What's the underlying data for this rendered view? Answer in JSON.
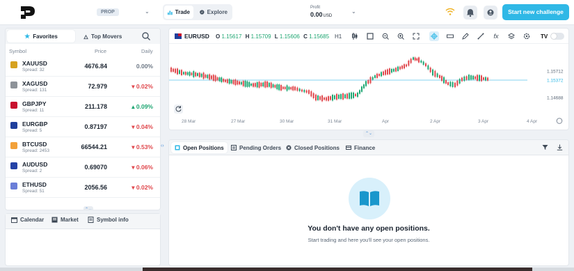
{
  "header": {
    "badge": "PROP",
    "mode_trade": "Trade",
    "mode_explore": "Explore",
    "profit_label": "Profit",
    "profit_value": "0.00",
    "profit_currency": "USD",
    "cta": "Start new challenge",
    "brand_color": "#2fb8e6"
  },
  "watchlist": {
    "tab_favorites": "Favorites",
    "tab_top_movers": "Top Movers",
    "col_symbol": "Symbol",
    "col_price": "Price",
    "col_daily": "Daily",
    "rows": [
      {
        "symbol": "XAUUSD",
        "spread": "Spread: 32",
        "price": "4676.84",
        "daily": "0.00%",
        "dir": "neu",
        "flag": "#d6a220"
      },
      {
        "symbol": "XAGUSD",
        "spread": "Spread: 131",
        "price": "72.979",
        "daily": "0.02%",
        "dir": "neg",
        "flag": "#8e9399"
      },
      {
        "symbol": "GBPJPY",
        "spread": "Spread: 11",
        "price": "211.178",
        "daily": "0.09%",
        "dir": "pos",
        "flag": "#c8102e"
      },
      {
        "symbol": "EURGBP",
        "spread": "Spread: 5",
        "price": "0.87197",
        "daily": "0.04%",
        "dir": "neg",
        "flag": "#1f3f9c"
      },
      {
        "symbol": "BTCUSD",
        "spread": "Spread: 2453",
        "price": "66544.21",
        "daily": "0.53%",
        "dir": "neg",
        "flag": "#f2a13a"
      },
      {
        "symbol": "AUDUSD",
        "spread": "Spread: 2",
        "price": "0.69070",
        "daily": "0.06%",
        "dir": "neg",
        "flag": "#2442a6"
      },
      {
        "symbol": "ETHUSD",
        "spread": "Spread: 51",
        "price": "2056.56",
        "daily": "0.02%",
        "dir": "neg",
        "flag": "#6b7ed8"
      }
    ]
  },
  "bottom_tabs": {
    "calendar": "Calendar",
    "market": "Market",
    "symbol_info": "Symbol info"
  },
  "chart": {
    "symbol": "EURUSD",
    "o_label": "O",
    "o_value": "1.15617",
    "h_label": "H",
    "h_value": "1.15709",
    "l_label": "L",
    "l_value": "1.15606",
    "c_label": "C",
    "c_value": "1.15685",
    "timeframe": "H1",
    "price_labels": [
      "1.15712",
      "1.15372",
      "1.14688"
    ],
    "x_labels": [
      "28 Mar",
      "27 Mar",
      "30 Mar",
      "31 Mar",
      "Apr",
      "2 Apr",
      "3 Apr",
      "4 Apr"
    ]
  },
  "positions": {
    "tab_open": "Open Positions",
    "tab_pending": "Pending Orders",
    "tab_closed": "Closed Positions",
    "tab_finance": "Finance",
    "empty_title": "You don't have any open positions.",
    "empty_sub": "Start trading and here you'll see your open positions."
  }
}
